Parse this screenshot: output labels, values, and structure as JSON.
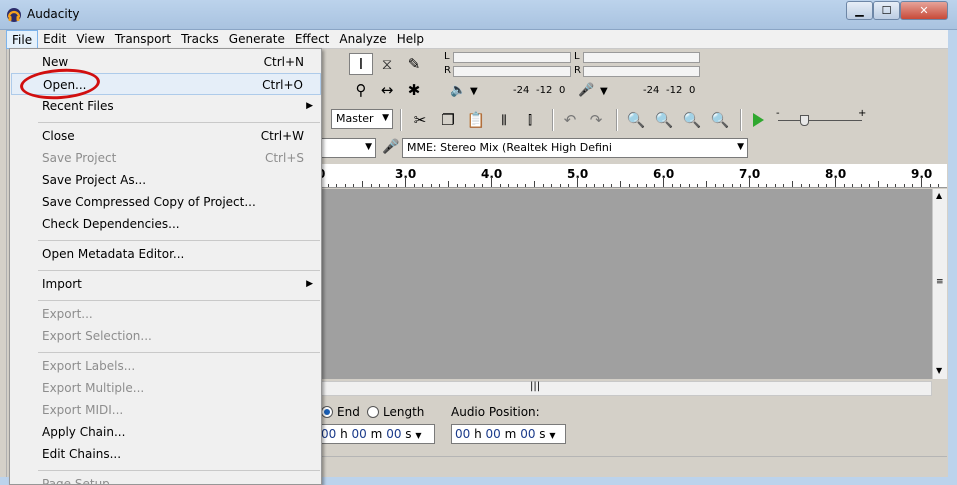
{
  "window": {
    "title": "Audacity",
    "minimize_icon": "minimize-icon",
    "maximize_icon": "maximize-icon",
    "close_icon": "close-icon"
  },
  "menubar": {
    "items": [
      "File",
      "Edit",
      "View",
      "Transport",
      "Tracks",
      "Generate",
      "Effect",
      "Analyze",
      "Help"
    ]
  },
  "file_menu": {
    "items": [
      {
        "label": "New",
        "shortcut": "Ctrl+N",
        "enabled": true
      },
      {
        "label": "Open...",
        "shortcut": "Ctrl+O",
        "enabled": true,
        "highlighted": true
      },
      {
        "label": "Recent Files",
        "submenu": true,
        "enabled": true
      },
      {
        "label": "Close",
        "shortcut": "Ctrl+W",
        "enabled": true
      },
      {
        "label": "Save Project",
        "shortcut": "Ctrl+S",
        "enabled": false
      },
      {
        "label": "Save Project As...",
        "enabled": true
      },
      {
        "label": "Save Compressed Copy of Project...",
        "enabled": true
      },
      {
        "label": "Check Dependencies...",
        "enabled": true
      },
      {
        "label": "Open Metadata Editor...",
        "enabled": true
      },
      {
        "label": "Import",
        "submenu": true,
        "enabled": true
      },
      {
        "label": "Export...",
        "enabled": false
      },
      {
        "label": "Export Selection...",
        "enabled": false
      },
      {
        "label": "Export Labels...",
        "enabled": false
      },
      {
        "label": "Export Multiple...",
        "enabled": false
      },
      {
        "label": "Export MIDI...",
        "enabled": false
      },
      {
        "label": "Apply Chain...",
        "enabled": true
      },
      {
        "label": "Edit Chains...",
        "enabled": true
      },
      {
        "label": "Page Setup...",
        "enabled": false
      }
    ]
  },
  "meters": {
    "playback": {
      "left": "L",
      "right": "R",
      "scale": [
        "-24",
        "-12",
        "0"
      ]
    },
    "recording": {
      "left": "L",
      "right": "R",
      "scale": [
        "-24",
        "-12",
        "0"
      ]
    }
  },
  "mixer": {
    "master_label": "Master"
  },
  "device": {
    "input_device": "MME: Stereo Mix (Realtek High Defini"
  },
  "ruler": {
    "labels": [
      "0",
      "3.0",
      "4.0",
      "5.0",
      "6.0",
      "7.0",
      "8.0",
      "9.0"
    ]
  },
  "selection": {
    "end_label": "End",
    "length_label": "Length",
    "audio_position_label": "Audio Position:",
    "selection_time": {
      "h": "00",
      "m": "00",
      "s": ""
    },
    "audio_position_time": {
      "h": "00",
      "m": "00",
      "s": ""
    },
    "unit_h": "h",
    "unit_m": "m",
    "unit_s": "s"
  },
  "colors": {
    "highlight_ring": "#d10f0f",
    "play_button": "#2fa82f"
  }
}
